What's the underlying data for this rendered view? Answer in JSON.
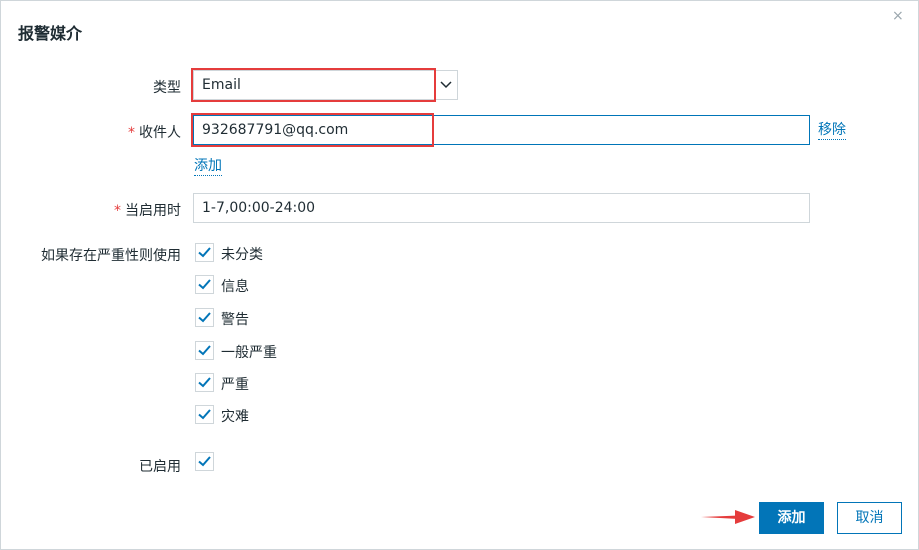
{
  "dialog": {
    "title": "报警媒介",
    "close_icon": "×"
  },
  "form": {
    "type": {
      "label": "类型",
      "value": "Email"
    },
    "recipient": {
      "label": "收件人",
      "required_mark": "*",
      "value": "932687791@qq.com",
      "remove_link": "移除"
    },
    "add_link": "添加",
    "when_active": {
      "label": "当启用时",
      "required_mark": "*",
      "value": "1-7,00:00-24:00"
    },
    "severity": {
      "label": "如果存在严重性则使用",
      "options": [
        {
          "label": "未分类",
          "checked": true
        },
        {
          "label": "信息",
          "checked": true
        },
        {
          "label": "警告",
          "checked": true
        },
        {
          "label": "一般严重",
          "checked": true
        },
        {
          "label": "严重",
          "checked": true
        },
        {
          "label": "灾难",
          "checked": true
        }
      ]
    },
    "enabled": {
      "label": "已启用",
      "checked": true
    }
  },
  "footer": {
    "add_button": "添加",
    "cancel_button": "取消"
  },
  "colors": {
    "accent": "#0275b8",
    "highlight": "#e53c3c"
  }
}
